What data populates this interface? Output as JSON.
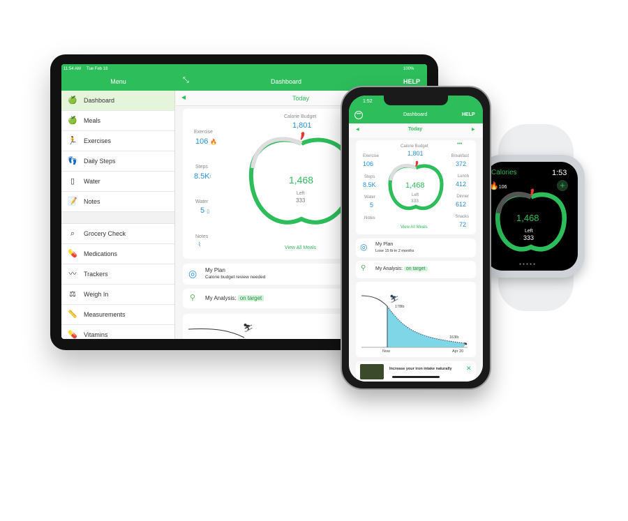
{
  "tablet": {
    "status": {
      "time": "11:54 AM",
      "date": "Tue Feb 18",
      "battery": "100%"
    },
    "menu_title": "Menu",
    "header_title": "Dashboard",
    "help": "HELP",
    "day": "Today",
    "sidebar": [
      {
        "label": "Dashboard",
        "icon": "dashboard-apple-icon"
      },
      {
        "label": "Meals",
        "icon": "apple-icon"
      },
      {
        "label": "Exercises",
        "icon": "runner-icon"
      },
      {
        "label": "Daily Steps",
        "icon": "footprints-icon"
      },
      {
        "label": "Water",
        "icon": "glass-icon"
      },
      {
        "label": "Notes",
        "icon": "notes-icon"
      },
      {
        "label": "Grocery Check",
        "icon": "magnifier-icon"
      },
      {
        "label": "Medications",
        "icon": "pill-icon"
      },
      {
        "label": "Trackers",
        "icon": "chart-line-icon"
      },
      {
        "label": "Weigh In",
        "icon": "scale-icon"
      },
      {
        "label": "Measurements",
        "icon": "ruler-icon"
      },
      {
        "label": "Vitamins",
        "icon": "vitamins-icon"
      }
    ],
    "summary": {
      "budget_label": "Calorie Budget",
      "budget": "1,801",
      "exercise_label": "Exercise",
      "exercise": "106",
      "steps_label": "Steps",
      "steps": "8.5K",
      "water_label": "Water",
      "water": "5",
      "notes_label": "Notes",
      "remaining": "1,468",
      "left_label": "Left",
      "left": "333",
      "view_all": "View All Meals",
      "progress_fraction": 0.82
    },
    "plan": {
      "title": "My Plan",
      "subtitle": "Calorie budget review needed"
    },
    "analysis": {
      "label": "My Analysis:",
      "status": "on target"
    }
  },
  "phone": {
    "status": {
      "time": "1:52"
    },
    "header_title": "Dashboard",
    "help": "HELP",
    "day": "Today",
    "summary": {
      "budget_label": "Calorie Budget",
      "budget": "1,801",
      "exercise_label": "Exercise",
      "exercise": "106",
      "steps_label": "Steps",
      "steps": "8.5K",
      "water_label": "Water",
      "water": "5",
      "notes_label": "Notes",
      "remaining": "1,468",
      "left_label": "Left",
      "left": "333",
      "view_all": "View All Meals",
      "meals": [
        {
          "label": "Breakfast",
          "value": "372"
        },
        {
          "label": "Lunch",
          "value": "412"
        },
        {
          "label": "Dinner",
          "value": "612"
        },
        {
          "label": "Snacks",
          "value": "72"
        }
      ]
    },
    "plan": {
      "title": "My Plan",
      "subtitle": "Lose 15 lb in 2 months"
    },
    "analysis": {
      "label": "My Analysis:",
      "status": "on target"
    },
    "weight_chart": {
      "start": "178lb",
      "end": "163lb",
      "x_start": "Now",
      "x_end": "Apr 20"
    },
    "tip": "Increase your iron intake naturally"
  },
  "watch": {
    "title": "Calories",
    "time": "1:53",
    "exercise": "106",
    "remaining": "1,468",
    "left_label": "Left",
    "left": "333"
  },
  "colors": {
    "brand": "#2ebd5b",
    "value": "#2a8fd6",
    "chart_fill": "#7fd6e6"
  }
}
